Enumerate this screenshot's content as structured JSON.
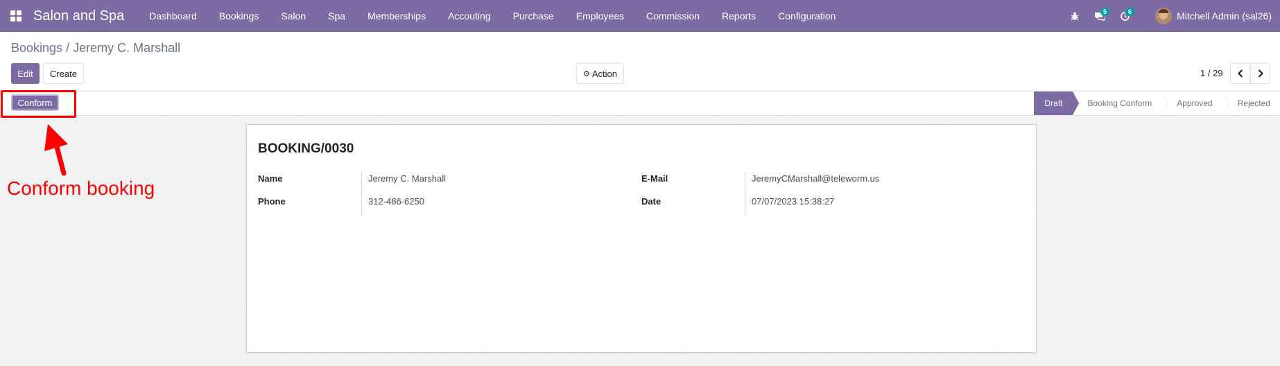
{
  "navbar": {
    "brand": "Salon and Spa",
    "menu": [
      "Dashboard",
      "Bookings",
      "Salon",
      "Spa",
      "Memberships",
      "Accouting",
      "Purchase",
      "Employees",
      "Commission",
      "Reports",
      "Configuration"
    ],
    "bug_icon": "bug-icon",
    "messages_badge": "5",
    "activities_badge": "6",
    "user_name": "Mitchell Admin (sal26)",
    "accent_color": "#7c6ca3",
    "badge_color": "#00a09d"
  },
  "breadcrumb": {
    "parent": "Bookings",
    "separator": "/",
    "current": "Jeremy C. Marshall"
  },
  "toolbar": {
    "edit_label": "Edit",
    "create_label": "Create",
    "action_label": "Action",
    "pager_value": "1 / 29"
  },
  "statusbar": {
    "conform_label": "Conform",
    "stages": [
      "Draft",
      "Booking Conform",
      "Approved",
      "Rejected"
    ],
    "active_stage": "Draft"
  },
  "form": {
    "reference": "BOOKING/0030",
    "fields": {
      "name_label": "Name",
      "name_value": "Jeremy C. Marshall",
      "phone_label": "Phone",
      "phone_value": "312-486-6250",
      "email_label": "E-Mail",
      "email_value": "JeremyCMarshall@teleworm.us",
      "date_label": "Date",
      "date_value": "07/07/2023 15:38:27"
    }
  },
  "annotation": {
    "text": "Conform booking",
    "color": "#ff0000"
  }
}
